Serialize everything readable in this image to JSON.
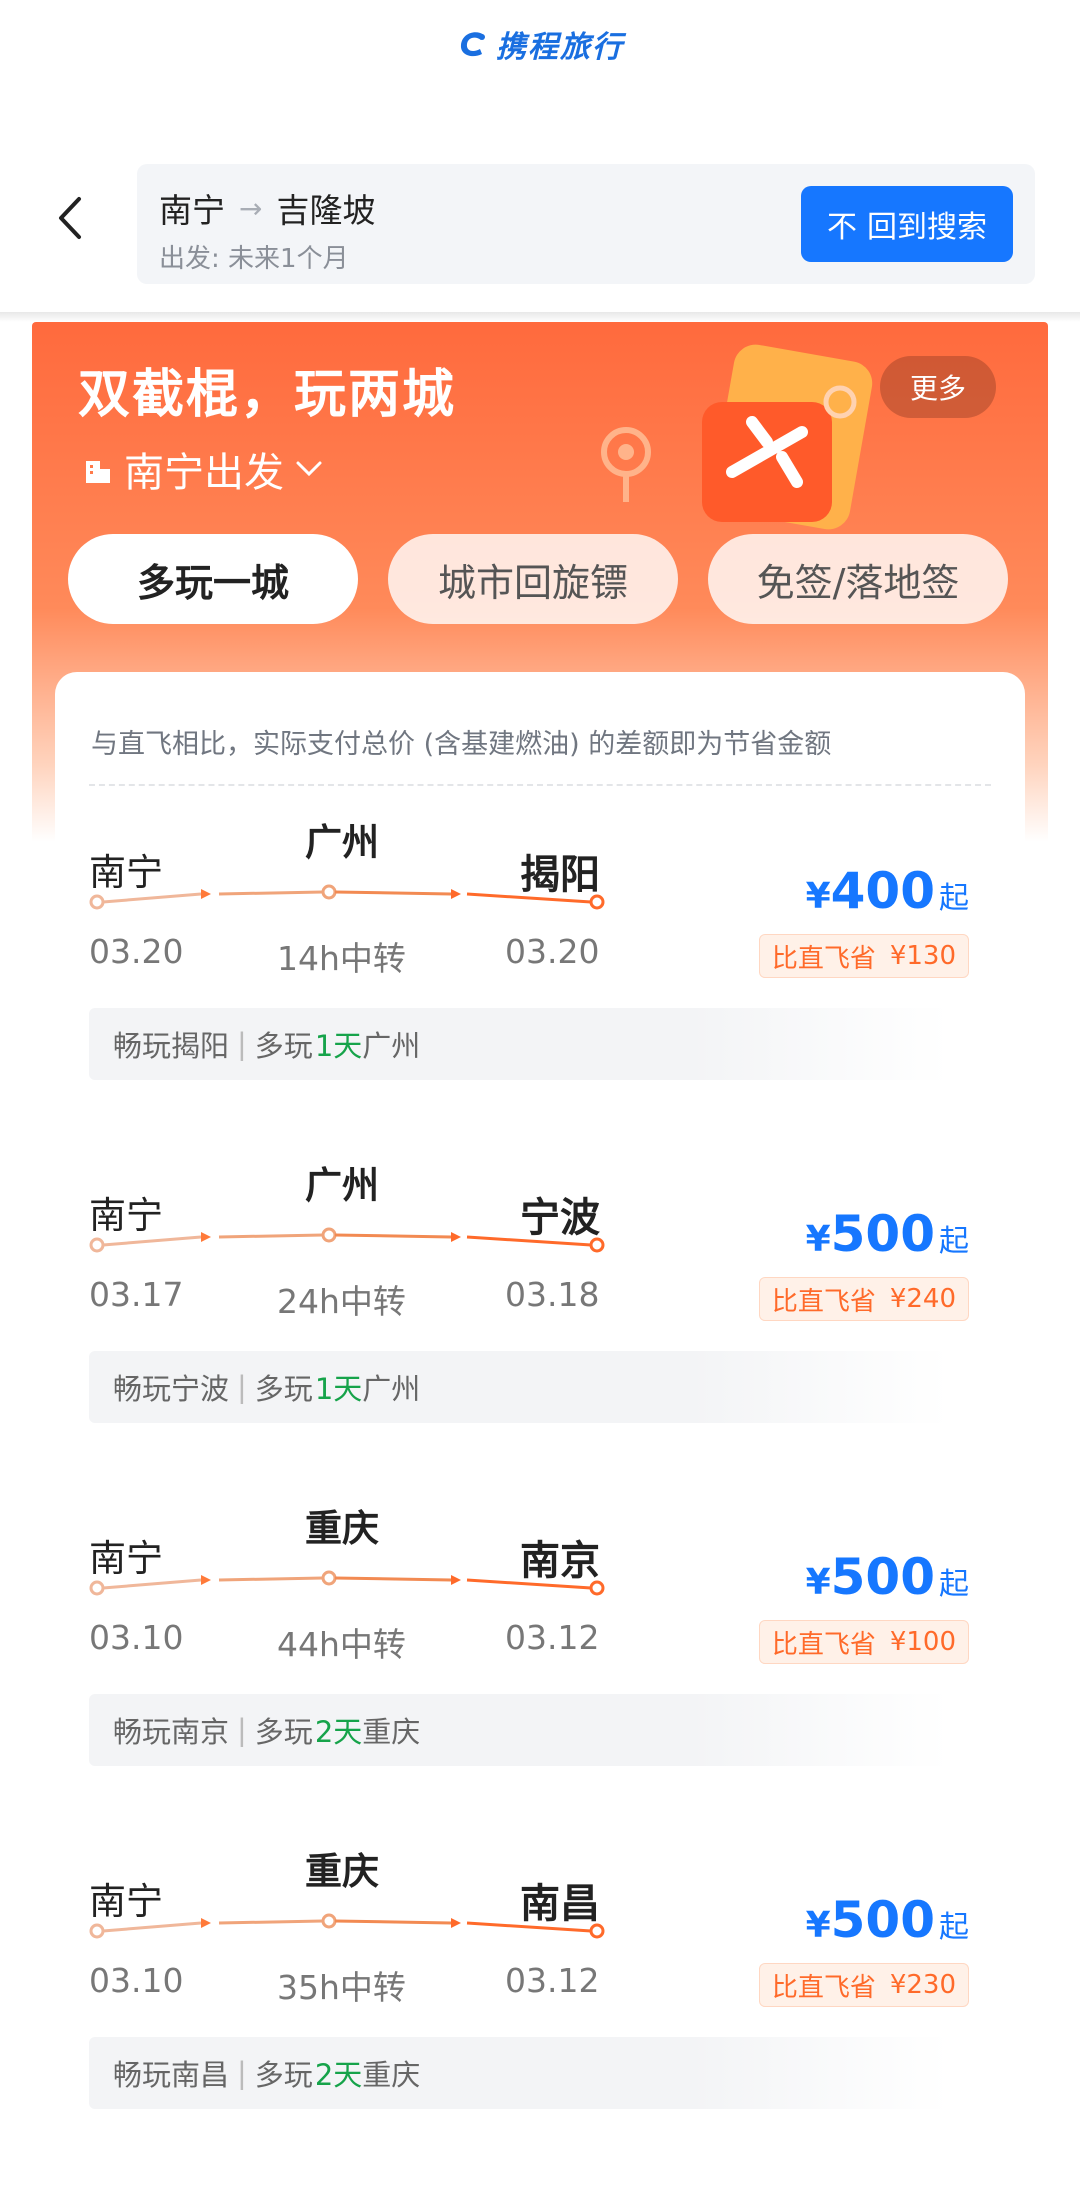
{
  "brand": {
    "name": "携程旅行"
  },
  "header": {
    "from": "南宁",
    "arrow": "→",
    "to": "吉隆坡",
    "subtitle": "出发: 未来1个月",
    "back_search_icon_char": "不",
    "back_search_label": "回到搜索"
  },
  "promo": {
    "title": "双截棍，玩两城",
    "depart_label": "南宁出发",
    "more_label": "更多",
    "tabs": [
      "多玩一城",
      "城市回旋镖",
      "免签/落地签"
    ],
    "active_tab": 0
  },
  "notice": "与直飞相比，实际支付总价 (含基建燃油) 的差额即为节省金额",
  "flights": [
    {
      "origin": "南宁",
      "via": "广州",
      "dest": "揭阳",
      "dep_date": "03.20",
      "transfer": "14h中转",
      "arr_date": "03.20",
      "price_symbol": "¥",
      "price": "400",
      "price_suffix": "起",
      "save_label": "比直飞省",
      "save_amount": "¥130",
      "tip_prefix": "畅玩揭阳",
      "tip_mid": "多玩",
      "tip_days": "1天",
      "tip_city": "广州"
    },
    {
      "origin": "南宁",
      "via": "广州",
      "dest": "宁波",
      "dep_date": "03.17",
      "transfer": "24h中转",
      "arr_date": "03.18",
      "price_symbol": "¥",
      "price": "500",
      "price_suffix": "起",
      "save_label": "比直飞省",
      "save_amount": "¥240",
      "tip_prefix": "畅玩宁波",
      "tip_mid": "多玩",
      "tip_days": "1天",
      "tip_city": "广州"
    },
    {
      "origin": "南宁",
      "via": "重庆",
      "dest": "南京",
      "dep_date": "03.10",
      "transfer": "44h中转",
      "arr_date": "03.12",
      "price_symbol": "¥",
      "price": "500",
      "price_suffix": "起",
      "save_label": "比直飞省",
      "save_amount": "¥100",
      "tip_prefix": "畅玩南京",
      "tip_mid": "多玩",
      "tip_days": "2天",
      "tip_city": "重庆"
    },
    {
      "origin": "南宁",
      "via": "重庆",
      "dest": "南昌",
      "dep_date": "03.10",
      "transfer": "35h中转",
      "arr_date": "03.12",
      "price_symbol": "¥",
      "price": "500",
      "price_suffix": "起",
      "save_label": "比直飞省",
      "save_amount": "¥230",
      "tip_prefix": "畅玩南昌",
      "tip_mid": "多玩",
      "tip_days": "2天",
      "tip_city": "重庆"
    }
  ],
  "colors": {
    "accent_blue": "#1677ff",
    "promo_orange": "#ff6a3d",
    "save_orange": "#ff6a2a",
    "days_green": "#16a34a"
  }
}
